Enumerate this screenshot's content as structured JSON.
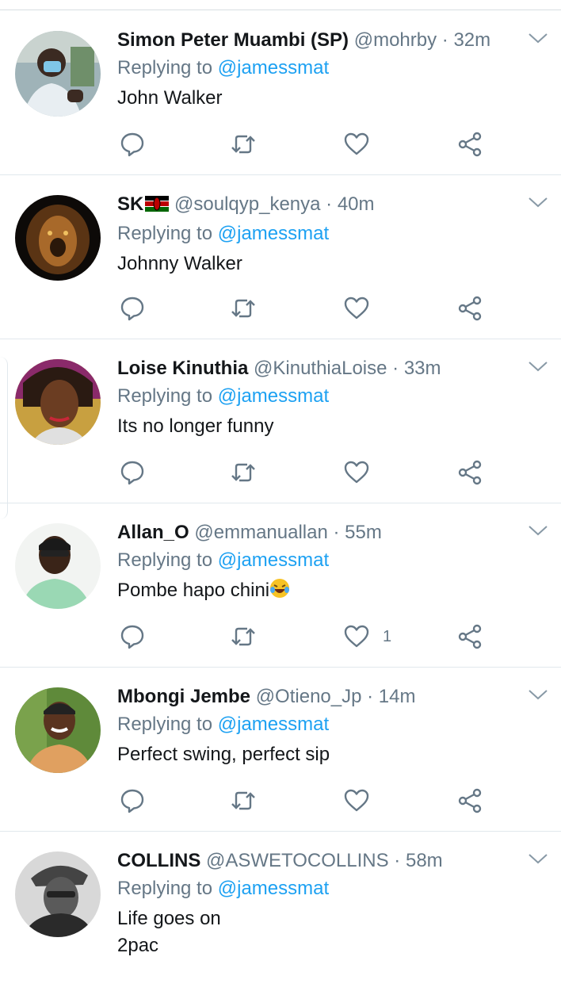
{
  "reply_prefix": "Replying to",
  "tweets": [
    {
      "name": "Simon Peter Muambi (SP)",
      "handle": "@mohrby",
      "time": "32m",
      "reply_to": "@jamessmat",
      "text": "John Walker",
      "likes": ""
    },
    {
      "name": "SK",
      "handle": "@soulqyp_kenya",
      "time": "40m",
      "reply_to": "@jamessmat",
      "text": "Johnny Walker",
      "likes": ""
    },
    {
      "name": "Loise Kinuthia",
      "handle": "@KinuthiaLoise",
      "time": "33m",
      "reply_to": "@jamessmat",
      "text": "Its no longer funny",
      "likes": ""
    },
    {
      "name": "Allan_O",
      "handle": "@emmanuallan",
      "time": "55m",
      "reply_to": "@jamessmat",
      "text": "Pombe hapo chini",
      "likes": "1"
    },
    {
      "name": "Mbongi Jembe",
      "handle": "@Otieno_Jp",
      "time": "14m",
      "reply_to": "@jamessmat",
      "text": "Perfect swing, perfect sip",
      "likes": ""
    },
    {
      "name": "COLLINS",
      "handle": "@ASWETOCOLLINS",
      "time": "58m",
      "reply_to": "@jamessmat",
      "text": "Life goes on\n2pac",
      "likes": ""
    }
  ],
  "colors": {
    "link": "#1da1f2",
    "secondary": "#657786",
    "primary_text": "#14171a",
    "divider": "#e1e8ed"
  },
  "icons": {
    "reply": "reply-icon",
    "retweet": "retweet-icon",
    "like": "heart-icon",
    "share": "share-icon",
    "menu": "chevron-down-icon",
    "flag": "kenya-flag-icon",
    "emoji": "laughing-tears-emoji"
  }
}
